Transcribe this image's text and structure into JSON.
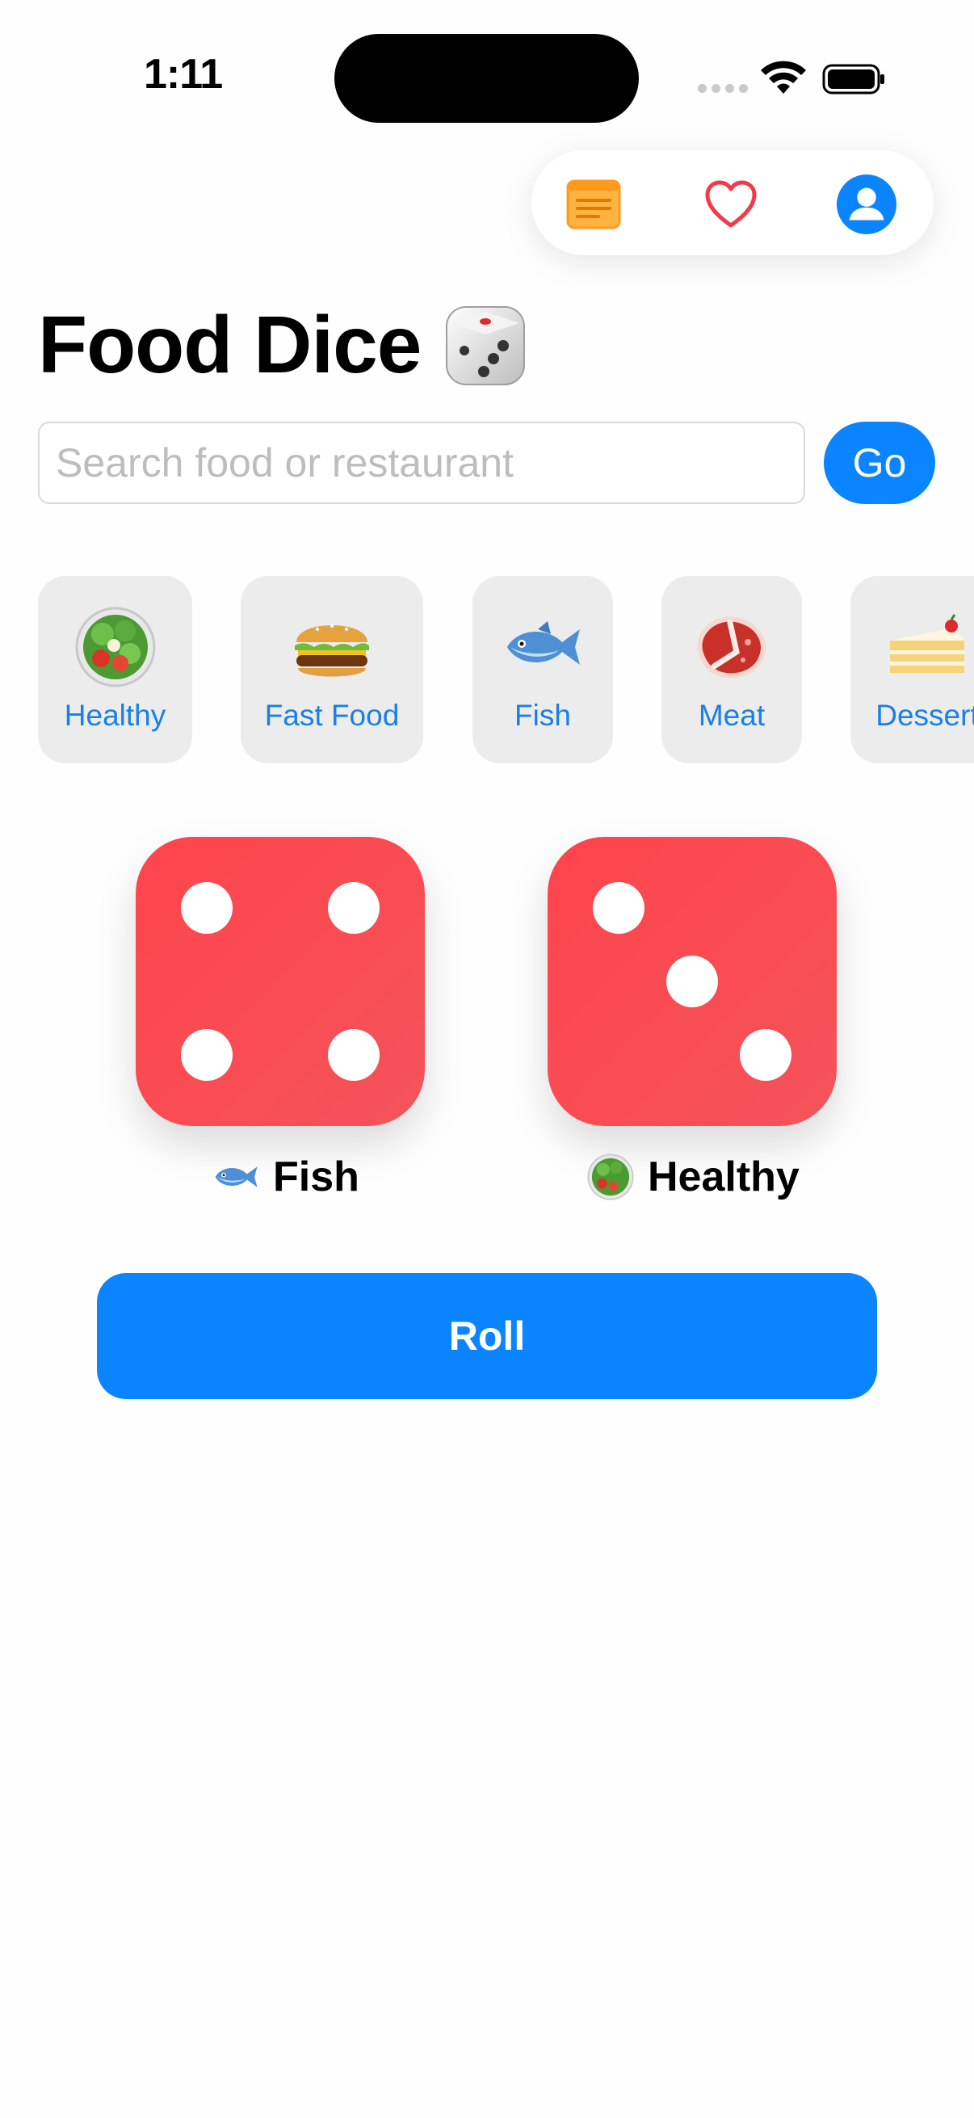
{
  "status_bar": {
    "time": "1:11"
  },
  "top_bar": {
    "icons": [
      "news-icon",
      "heart-icon",
      "person-circle-icon"
    ]
  },
  "header": {
    "title": "Food Dice",
    "title_icon": "game-die-icon"
  },
  "search": {
    "placeholder": "Search food or restaurant",
    "value": "",
    "go_label": "Go"
  },
  "categories": [
    {
      "label": "Healthy",
      "icon": "salad-icon"
    },
    {
      "label": "Fast Food",
      "icon": "hamburger-icon"
    },
    {
      "label": "Fish",
      "icon": "fish-icon"
    },
    {
      "label": "Meat",
      "icon": "meat-icon"
    },
    {
      "label": "Dessert",
      "icon": "cake-icon"
    }
  ],
  "dice": [
    {
      "face_value": 4,
      "label": "Fish",
      "icon": "fish-icon"
    },
    {
      "face_value": 3,
      "label": "Healthy",
      "icon": "salad-icon"
    }
  ],
  "roll_label": "Roll",
  "colors": {
    "accent": "#0a84ff",
    "die_red": "#ff444c",
    "news_orange": "#ff9a1f",
    "heart_red": "#f23a4a",
    "category_bg": "#ececec",
    "category_text": "#1a7fe6"
  }
}
